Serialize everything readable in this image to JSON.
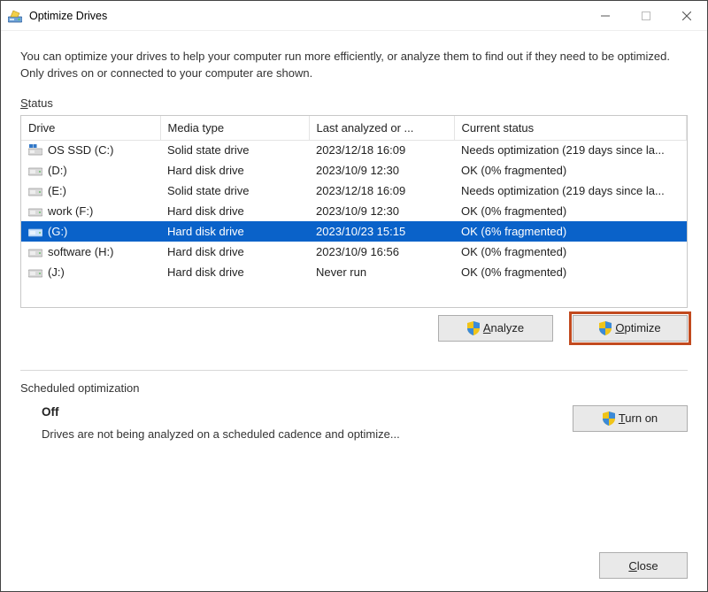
{
  "window": {
    "title": "Optimize Drives"
  },
  "intro": "You can optimize your drives to help your computer run more efficiently, or analyze them to find out if they need to be optimized. Only drives on or connected to your computer are shown.",
  "status_label_prefix": "S",
  "status_label_rest": "tatus",
  "columns": {
    "drive": "Drive",
    "media": "Media type",
    "last": "Last analyzed or ...",
    "status": "Current status"
  },
  "drives": [
    {
      "icon": "ssd-system",
      "name": "OS SSD (C:)",
      "media": "Solid state drive",
      "last": "2023/12/18 16:09",
      "status": "Needs optimization (219 days since la...",
      "selected": false
    },
    {
      "icon": "hdd",
      "name": "(D:)",
      "media": "Hard disk drive",
      "last": "2023/10/9 12:30",
      "status": "OK (0% fragmented)",
      "selected": false
    },
    {
      "icon": "hdd",
      "name": "(E:)",
      "media": "Solid state drive",
      "last": "2023/12/18 16:09",
      "status": "Needs optimization (219 days since la...",
      "selected": false
    },
    {
      "icon": "hdd",
      "name": "work (F:)",
      "media": "Hard disk drive",
      "last": "2023/10/9 12:30",
      "status": "OK (0% fragmented)",
      "selected": false
    },
    {
      "icon": "hdd",
      "name": "(G:)",
      "media": "Hard disk drive",
      "last": "2023/10/23 15:15",
      "status": "OK (6% fragmented)",
      "selected": true
    },
    {
      "icon": "hdd",
      "name": "software (H:)",
      "media": "Hard disk drive",
      "last": "2023/10/9 16:56",
      "status": "OK (0% fragmented)",
      "selected": false
    },
    {
      "icon": "hdd",
      "name": "(J:)",
      "media": "Hard disk drive",
      "last": "Never run",
      "status": "OK (0% fragmented)",
      "selected": false
    }
  ],
  "buttons": {
    "analyze_accel": "A",
    "analyze_rest": "nalyze",
    "optimize_accel": "O",
    "optimize_rest": "ptimize",
    "turnon_accel": "T",
    "turnon_rest": "urn on",
    "close_accel": "C",
    "close_rest": "lose"
  },
  "scheduled": {
    "header": "Scheduled optimization",
    "state": "Off",
    "desc": "Drives are not being analyzed on a scheduled cadence and optimize..."
  },
  "colors": {
    "selection": "#0a62c9",
    "highlight_outline": "#c24a1f"
  }
}
